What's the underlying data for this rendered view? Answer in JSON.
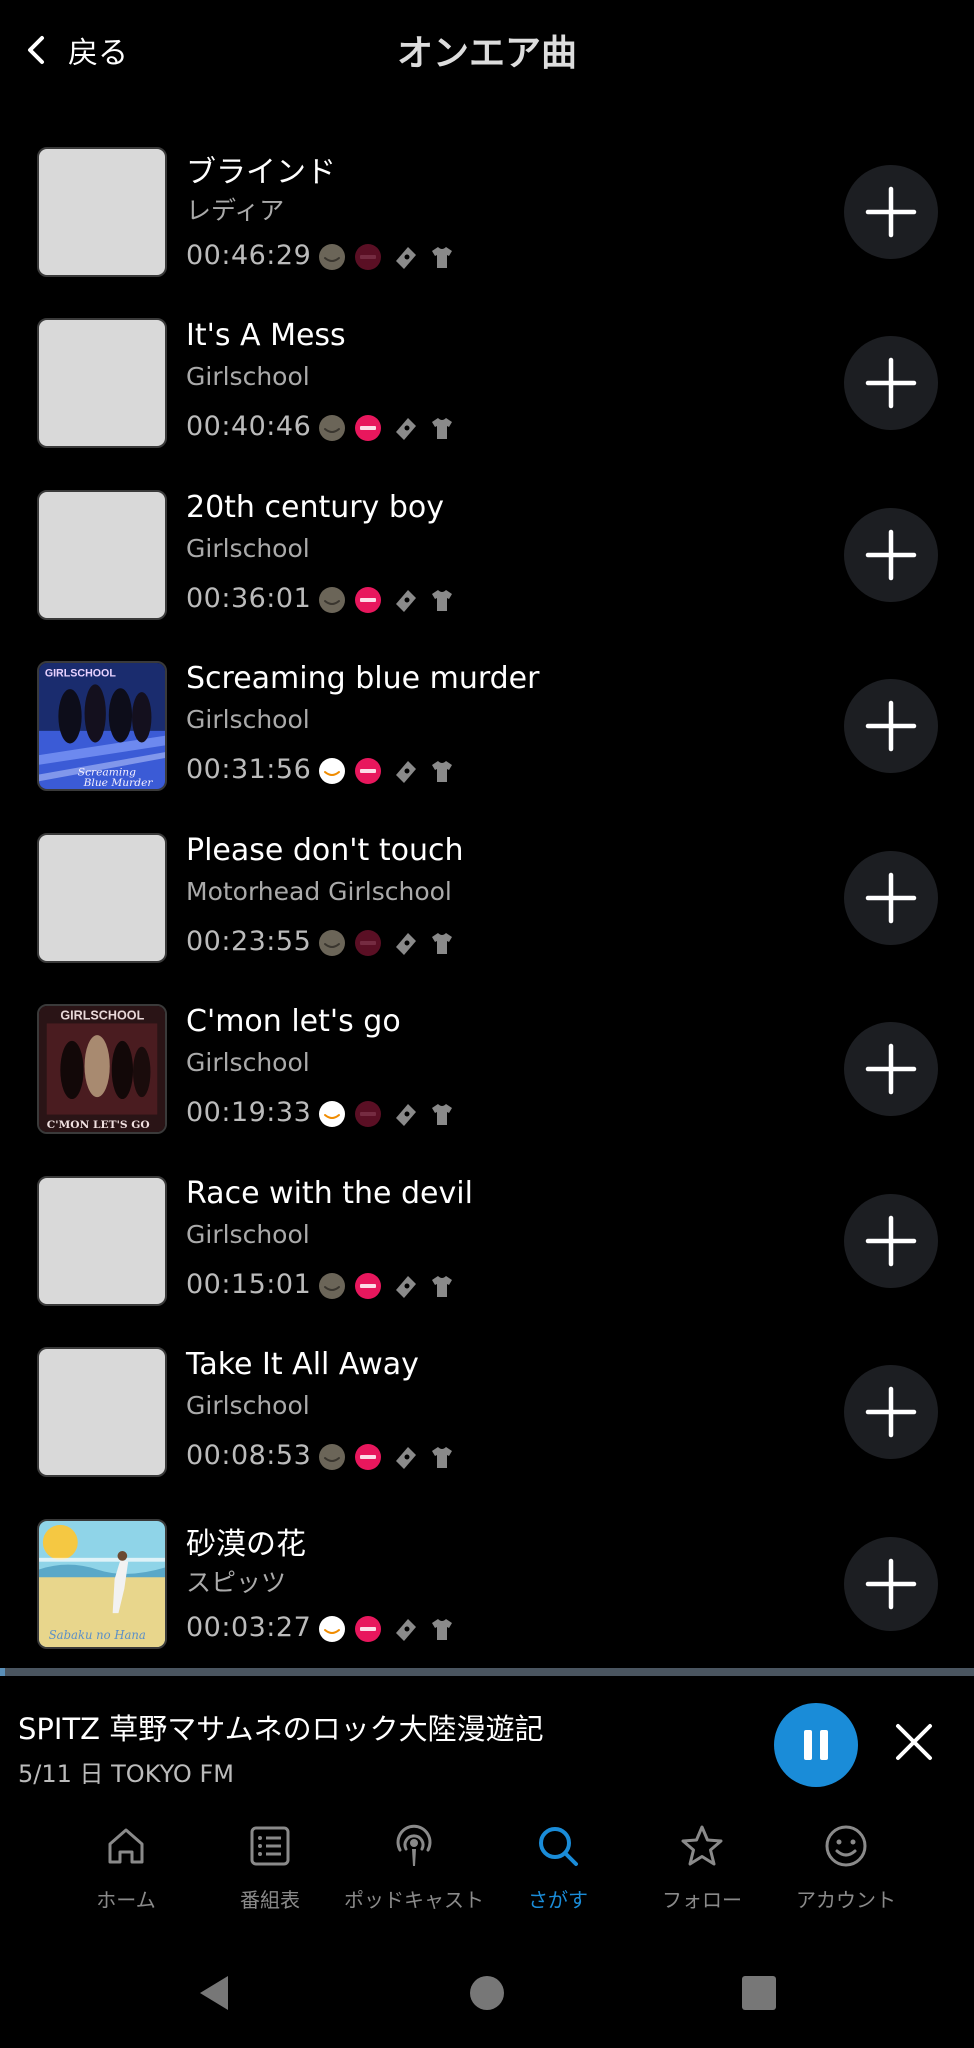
{
  "header": {
    "back_label": "戻る",
    "title": "オンエア曲"
  },
  "tracks": [
    {
      "title": "ブラインド",
      "artist": "レディア",
      "time": "00:46:29",
      "art": "placeholder",
      "amazon_active": false,
      "recochoku_active": false
    },
    {
      "title": "It's A Mess",
      "artist": "Girlschool",
      "time": "00:40:46",
      "art": "placeholder",
      "amazon_active": false,
      "recochoku_active": true
    },
    {
      "title": "20th century boy",
      "artist": "Girlschool",
      "time": "00:36:01",
      "art": "placeholder",
      "amazon_active": false,
      "recochoku_active": true
    },
    {
      "title": "Screaming blue murder",
      "artist": "Girlschool",
      "time": "00:31:56",
      "art": "album-cover",
      "amazon_active": true,
      "recochoku_active": true
    },
    {
      "title": "Please don't touch",
      "artist": "Motorhead Girlschool",
      "time": "00:23:55",
      "art": "placeholder",
      "amazon_active": false,
      "recochoku_active": false
    },
    {
      "title": "C'mon let's go",
      "artist": "Girlschool",
      "time": "00:19:33",
      "art": "album-cover",
      "amazon_active": true,
      "recochoku_active": false
    },
    {
      "title": "Race with the devil",
      "artist": "Girlschool",
      "time": "00:15:01",
      "art": "placeholder",
      "amazon_active": false,
      "recochoku_active": true
    },
    {
      "title": "Take It All Away",
      "artist": "Girlschool",
      "time": "00:08:53",
      "art": "placeholder",
      "amazon_active": false,
      "recochoku_active": true
    },
    {
      "title": "砂漠の花",
      "artist": "スピッツ",
      "time": "00:03:27",
      "art": "album-cover",
      "amazon_active": true,
      "recochoku_active": true
    }
  ],
  "player": {
    "title": "SPITZ 草野マサムネのロック大陸漫遊記",
    "subtitle": "5/11 日 TOKYO FM",
    "progress": 0.005,
    "state": "playing"
  },
  "nav": [
    {
      "label": "ホーム",
      "icon": "home-icon",
      "active": false
    },
    {
      "label": "番組表",
      "icon": "program-guide-icon",
      "active": false
    },
    {
      "label": "ポッドキャスト",
      "icon": "podcast-icon",
      "active": false
    },
    {
      "label": "さがす",
      "icon": "search-icon",
      "active": true
    },
    {
      "label": "フォロー",
      "icon": "star-icon",
      "active": false
    },
    {
      "label": "アカウント",
      "icon": "account-icon",
      "active": false
    }
  ],
  "colors": {
    "accent": "#1a8cd8",
    "background": "#000000",
    "recochoku": "#e8175d",
    "amazon_active": "#ffffff",
    "amazon_inactive": "#6b6558"
  }
}
